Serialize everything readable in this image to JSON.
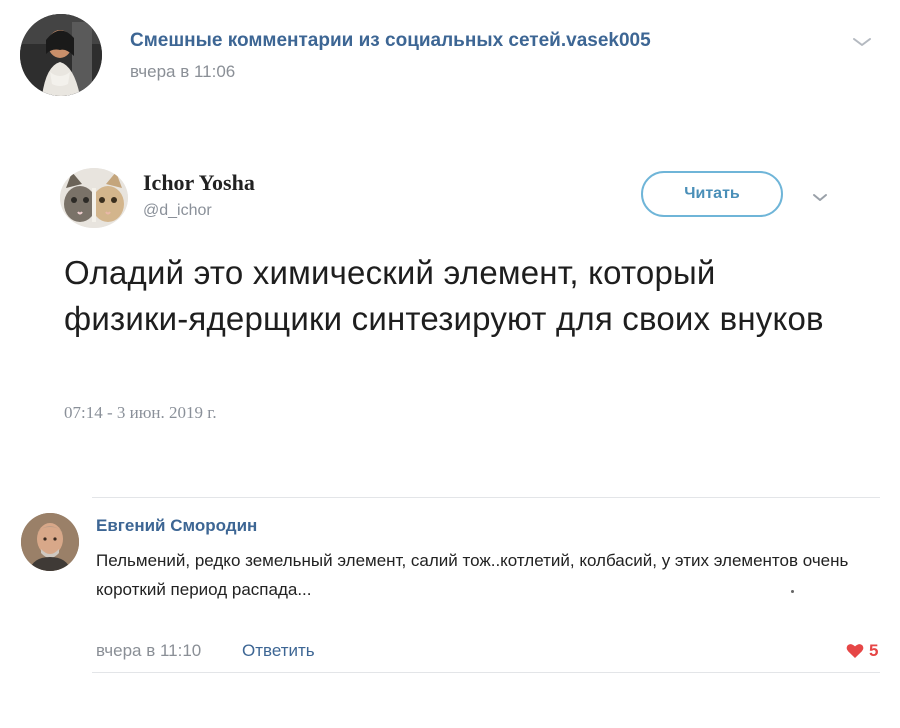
{
  "post": {
    "group_name": "Смешные комментарии из социальных сетей.vasek005",
    "time": "вчера в 11:06",
    "menu_icon": "chevron-down-icon"
  },
  "tweet": {
    "author_name": "Ichor Yosha",
    "handle": "@d_ichor",
    "follow_label": "Читать",
    "text": "Оладий это химический элемент, который физики-ядерщики синтезируют для своих внуков",
    "date": "07:14 - 3 июн. 2019 г.",
    "accent_color": "#6fb5d8"
  },
  "comment": {
    "author": "Евгений Смородин",
    "text": "Пельмений, редко земельный элемент, салий тож..котлетий, колбасий, у этих элементов очень короткий период распада...",
    "time": "вчера в 11:10",
    "reply_label": "Ответить",
    "likes": "5",
    "like_color": "#e64646"
  },
  "colors": {
    "link": "#3d6694",
    "muted": "#8a8f96"
  }
}
